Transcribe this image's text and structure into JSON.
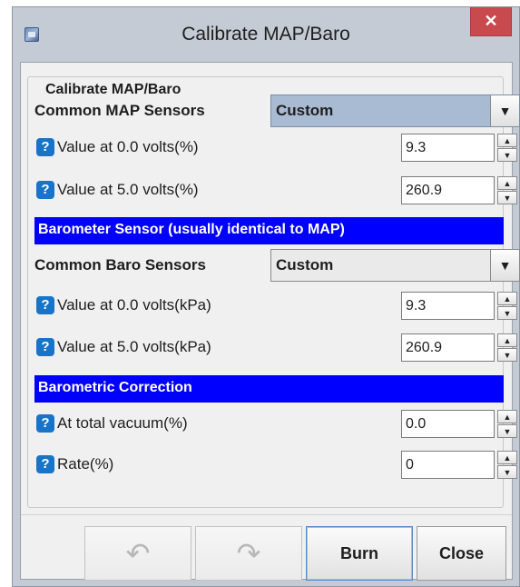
{
  "window": {
    "title": "Calibrate MAP/Baro",
    "app_icon": "dialog-app-icon",
    "close_glyph": "✕"
  },
  "group": {
    "title": "Calibrate MAP/Baro"
  },
  "map": {
    "common_label": "Common MAP Sensors",
    "common_value": "Custom",
    "v0_label": "Value at 0.0 volts(%)",
    "v0_value": "9.3",
    "v5_label": "Value at 5.0 volts(%)",
    "v5_value": "260.9"
  },
  "baro_header": "Barometer Sensor (usually identical to MAP)",
  "baro": {
    "common_label": "Common Baro Sensors",
    "common_value": "Custom",
    "v0_label": "Value at 0.0 volts(kPa)",
    "v0_value": "9.3",
    "v5_label": "Value at 5.0 volts(kPa)",
    "v5_value": "260.9"
  },
  "correction_header": "Barometric Correction",
  "correction": {
    "vacuum_label": "At total vacuum(%)",
    "vacuum_value": "0.0",
    "rate_label": "Rate(%)",
    "rate_value": "0"
  },
  "glyphs": {
    "help": "?",
    "dropdown": "▼",
    "spin_up": "▲",
    "spin_down": "▼",
    "undo": "↶",
    "redo": "↷"
  },
  "buttons": {
    "burn_label": "Burn",
    "close_label": "Close"
  },
  "colors": {
    "section_bar": "#0000ff",
    "help_icon": "#1874c8",
    "close_button": "#c84a4f"
  }
}
